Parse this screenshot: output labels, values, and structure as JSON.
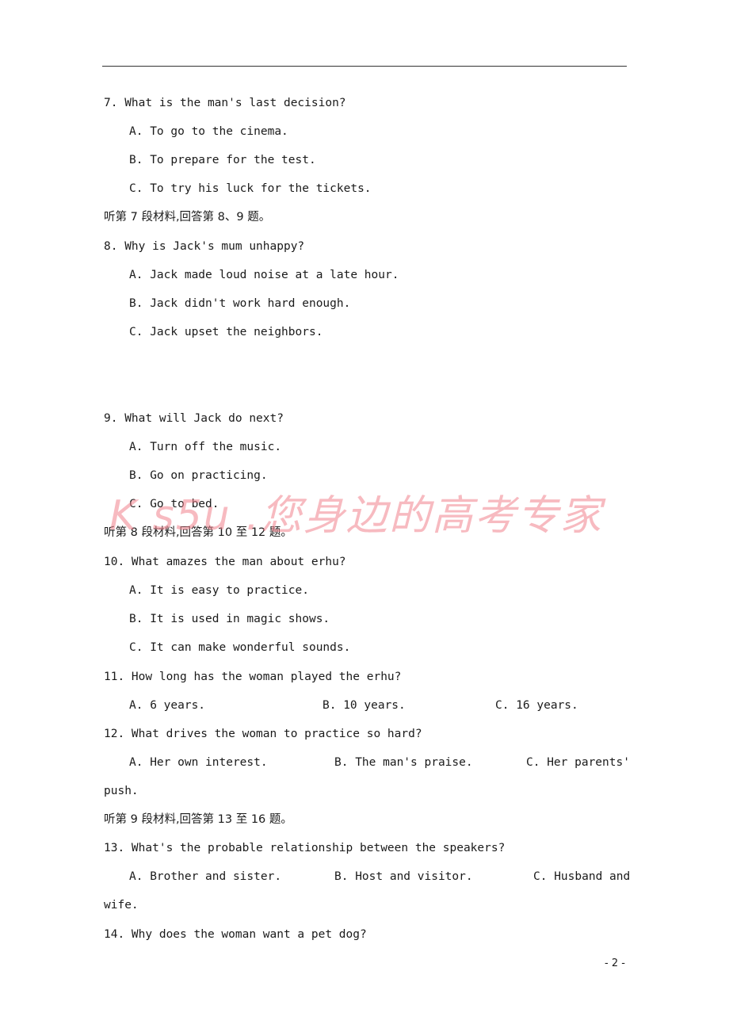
{
  "watermark": "K s5u .您身边的高考专家",
  "page_number": "- 2 -",
  "lines": {
    "q7": "7. What is the man's last decision?",
    "q7a": "A. To go to the cinema.",
    "q7b": "B. To prepare for the test.",
    "q7c": "C. To try his luck for the tickets.",
    "s7": "听第 7 段材料,回答第 8、9 题。",
    "q8": "8. Why is Jack's mum unhappy?",
    "q8a": "A. Jack made loud noise at a late hour.",
    "q8b": "B. Jack didn't work hard enough.",
    "q8c": "C. Jack upset the neighbors.",
    "q9": "9. What will Jack do next?",
    "q9a": "A. Turn off the music.",
    "q9b": "B. Go on practicing.",
    "q9c": "C. Go to bed.",
    "s8": "听第 8 段材料,回答第 10 至 12 题。",
    "q10": "10. What amazes the man about erhu?",
    "q10a": "A. It is easy to practice.",
    "q10b": "B. It is used in magic shows.",
    "q10c": "C. It can make wonderful sounds.",
    "q11": "11. How long has the woman played the erhu?",
    "q11a": "A. 6 years.",
    "q11b": "B. 10 years.",
    "q11c": "C. 16 years.",
    "q12": "12. What drives the woman to practice so hard?",
    "q12a": "A. Her own interest.",
    "q12b": "B. The man's praise.",
    "q12c": "C. Her parents'",
    "q12c_cont": "push.",
    "s9": "听第 9 段材料,回答第 13 至 16 题。",
    "q13": "13. What's the probable relationship between the speakers?",
    "q13a": "A. Brother and sister.",
    "q13b": "B. Host and visitor.",
    "q13c": "C. Husband and",
    "q13c_cont": "wife.",
    "q14": "14. Why does the woman want a pet dog?"
  }
}
